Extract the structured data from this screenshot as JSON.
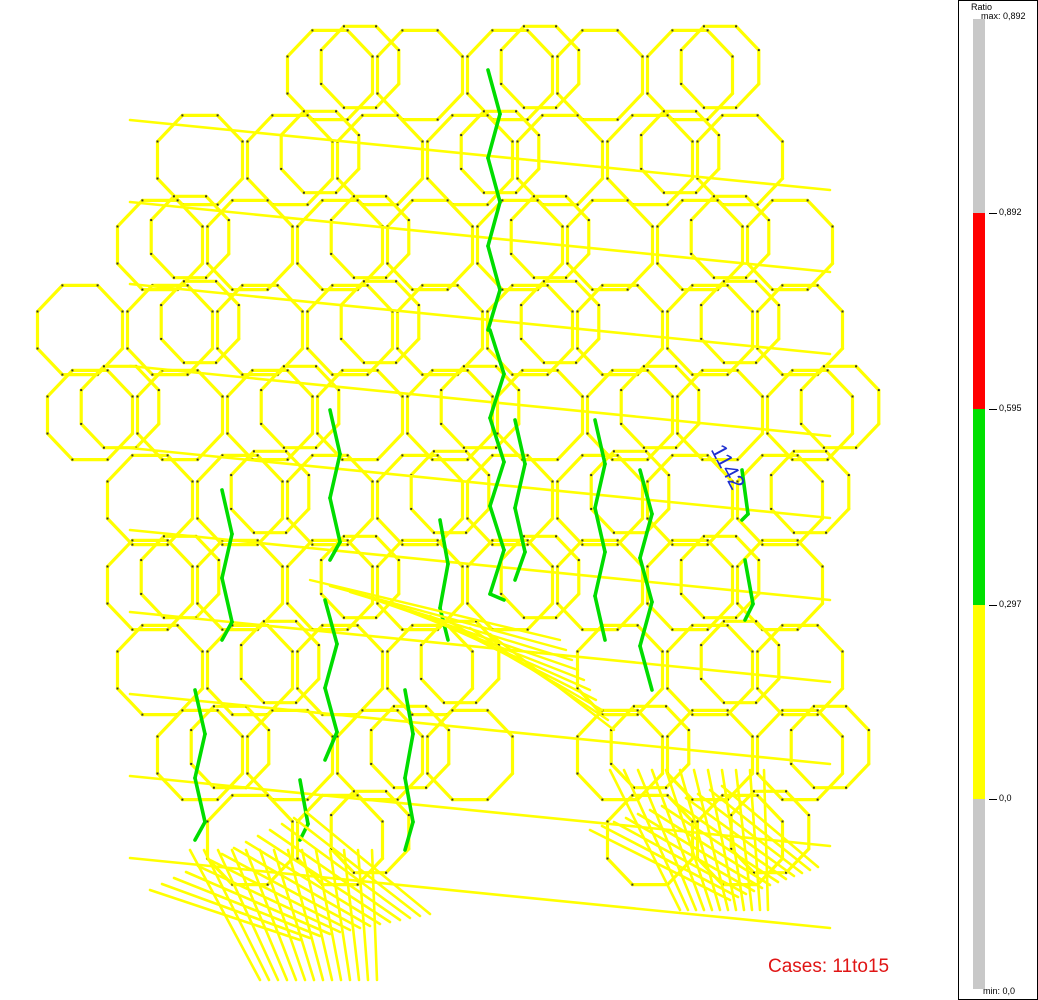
{
  "legend": {
    "title": "Ratio",
    "max_text": "max: 0,892",
    "min_text": "min:   0,0",
    "ticks": [
      "0,892",
      "0,595",
      "0,297",
      "0,0"
    ],
    "segments": [
      {
        "name": "above-max",
        "color": "#c8c8c8"
      },
      {
        "name": "range-595-892",
        "color": "#ff0000"
      },
      {
        "name": "range-297-595",
        "color": "#00e000"
      },
      {
        "name": "range-0-297",
        "color": "#ffff00"
      },
      {
        "name": "below-min",
        "color": "#c8c8c8"
      }
    ]
  },
  "member_label": "1142",
  "cases_label": "Cases: 11to15",
  "colors": {
    "member_low": "#ffff00",
    "member_mid": "#00dd00",
    "node": "#303030"
  }
}
